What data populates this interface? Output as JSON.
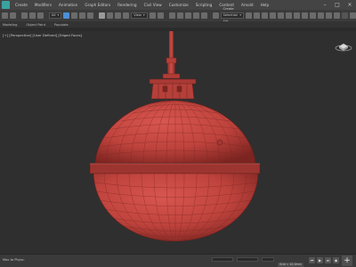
{
  "menu": {
    "items": [
      "Create",
      "Modifiers",
      "Animation",
      "Graph Editors",
      "Rendering",
      "Civil View",
      "Customize",
      "Scripting",
      "Content",
      "Arnold",
      "Help"
    ]
  },
  "toolbar": {
    "selection_filter": "All",
    "reference_coord": "View",
    "named_selection": "Create Selection Set"
  },
  "ribbon": {
    "tabs": [
      "Modeling",
      "Object Paint",
      "Populate"
    ]
  },
  "viewport": {
    "label": "[+] [Perspective] [User Defined] [Edged Faces]",
    "object": "spherical pendant lamp",
    "object_color": "#c0453f",
    "background_color": "#2f2f2f"
  },
  "statusbar": {
    "script_label": "Max to Physc.",
    "grid_readout": "Grid = 10.0mm",
    "add_time_tag": "Add Time Tag"
  },
  "colors": {
    "menubar": "#444444",
    "toolbar": "#3b3b3b",
    "accent_blue": "#4b8fd6",
    "lamp_red": "#c0453f",
    "lamp_dark": "#8a2a26"
  }
}
